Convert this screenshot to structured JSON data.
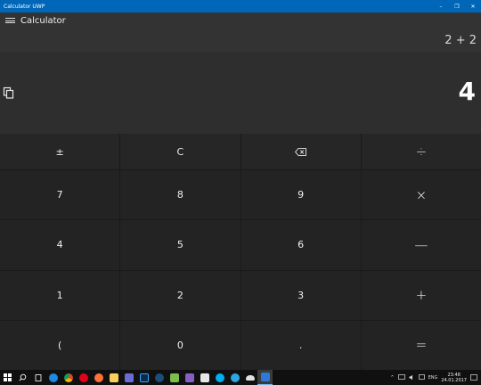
{
  "window": {
    "title": "Calculator UWP",
    "minimize": "–",
    "restore": "❐",
    "close": "✕"
  },
  "appbar": {
    "app_name": "Calculator"
  },
  "display": {
    "expression": "2 + 2",
    "result": "4"
  },
  "keys": {
    "plus_minus": "±",
    "clear": "C",
    "backspace": "⌫",
    "divide": "÷",
    "seven": "7",
    "eight": "8",
    "nine": "9",
    "multiply": "×",
    "four": "4",
    "five": "5",
    "six": "6",
    "subtract": "—",
    "one": "1",
    "two": "2",
    "three": "3",
    "add": "+",
    "open_paren": "(",
    "zero": "0",
    "decimal": ".",
    "equals": "="
  },
  "taskbar": {
    "language": "ENG",
    "time": "23:48",
    "date": "24.01.2017",
    "tray_arrow": "^"
  },
  "colors": {
    "title_bar": "#0067b8",
    "app_bar": "#333333",
    "display": "#2e2e2e",
    "key": "#232323",
    "taskbar": "#101010"
  }
}
